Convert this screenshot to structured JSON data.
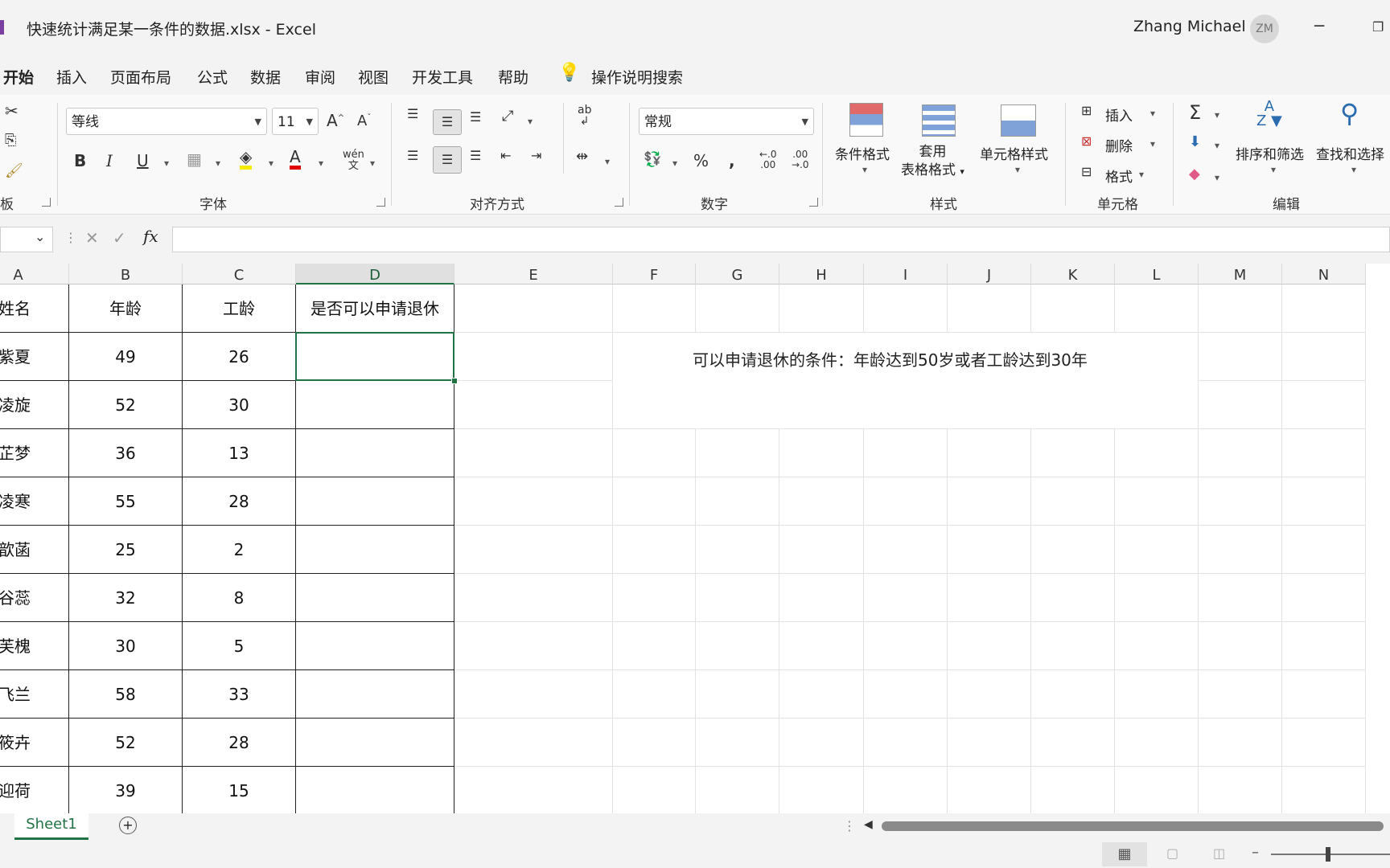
{
  "titlebar": {
    "title": "快速统计满足某一条件的数据.xlsx  -  Excel",
    "user_name": "Zhang Michael",
    "avatar_initials": "ZM"
  },
  "menu": {
    "tabs": [
      "开始",
      "插入",
      "页面布局",
      "公式",
      "数据",
      "审阅",
      "视图",
      "开发工具",
      "帮助"
    ],
    "tell_me": "操作说明搜索"
  },
  "ribbon": {
    "font_name": "等线",
    "font_size": "11",
    "phonetic": "wén",
    "number_format": "常规",
    "groups": {
      "clipboard": "板",
      "font": "字体",
      "alignment": "对齐方式",
      "number": "数字",
      "styles": "样式",
      "cells": "单元格",
      "editing": "编辑"
    },
    "styles_buttons": {
      "conditional": "条件格式",
      "table_line1": "套用",
      "table_line2": "表格格式",
      "cell_styles": "单元格样式"
    },
    "cells_buttons": {
      "insert": "插入",
      "delete": "删除",
      "format": "格式"
    },
    "editing_buttons": {
      "sort": "排序和筛选",
      "find": "查找和选择"
    }
  },
  "formula_bar": {
    "fx": "fx",
    "content": ""
  },
  "columns": [
    "A",
    "B",
    "C",
    "D",
    "E",
    "F",
    "G",
    "H",
    "I",
    "J",
    "K",
    "L",
    "M",
    "N"
  ],
  "selected_column": "D",
  "table": {
    "headers": [
      "姓名",
      "年龄",
      "工龄",
      "是否可以申请退休"
    ],
    "rows": [
      [
        "紫夏",
        "49",
        "26",
        ""
      ],
      [
        "凌旋",
        "52",
        "30",
        ""
      ],
      [
        "芷梦",
        "36",
        "13",
        ""
      ],
      [
        "凌寒",
        "55",
        "28",
        ""
      ],
      [
        "歆菡",
        "25",
        "2",
        ""
      ],
      [
        "谷蕊",
        "32",
        "8",
        ""
      ],
      [
        "芙槐",
        "30",
        "5",
        ""
      ],
      [
        "飞兰",
        "58",
        "33",
        ""
      ],
      [
        "筱卉",
        "52",
        "28",
        ""
      ],
      [
        "迎荷",
        "39",
        "15",
        ""
      ]
    ]
  },
  "note": "可以申请退休的条件：年龄达到50岁或者工龄达到30年",
  "sheets": {
    "active": "Sheet1"
  },
  "colors": {
    "accent": "#217346"
  }
}
